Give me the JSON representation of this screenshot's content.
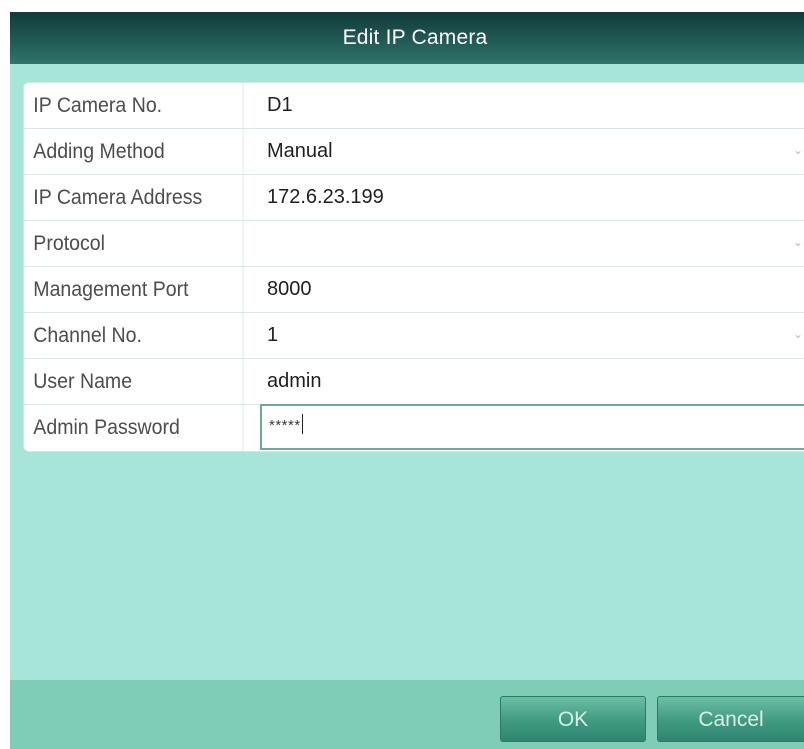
{
  "dialog": {
    "title": "Edit IP Camera"
  },
  "fields": [
    {
      "label": "IP Camera No.",
      "value": "D1",
      "type": "text"
    },
    {
      "label": "Adding Method",
      "value": "Manual",
      "type": "select"
    },
    {
      "label": "IP Camera Address",
      "value": "172.6.23.199",
      "type": "text"
    },
    {
      "label": "Protocol",
      "value": "",
      "type": "select"
    },
    {
      "label": "Management Port",
      "value": "8000",
      "type": "text"
    },
    {
      "label": "Channel No.",
      "value": "1",
      "type": "select"
    },
    {
      "label": "User Name",
      "value": "admin",
      "type": "text"
    },
    {
      "label": "Admin Password",
      "value": "*****",
      "type": "password"
    }
  ],
  "buttons": {
    "ok_label": "OK",
    "cancel_label": "Cancel"
  },
  "icons": {
    "dropdown": "chevron-down-icon"
  },
  "colors": {
    "title_bar": "#1e5451",
    "body_background": "#a6e5d8",
    "footer": "#7fcdb7",
    "button": "#3f9a80"
  }
}
